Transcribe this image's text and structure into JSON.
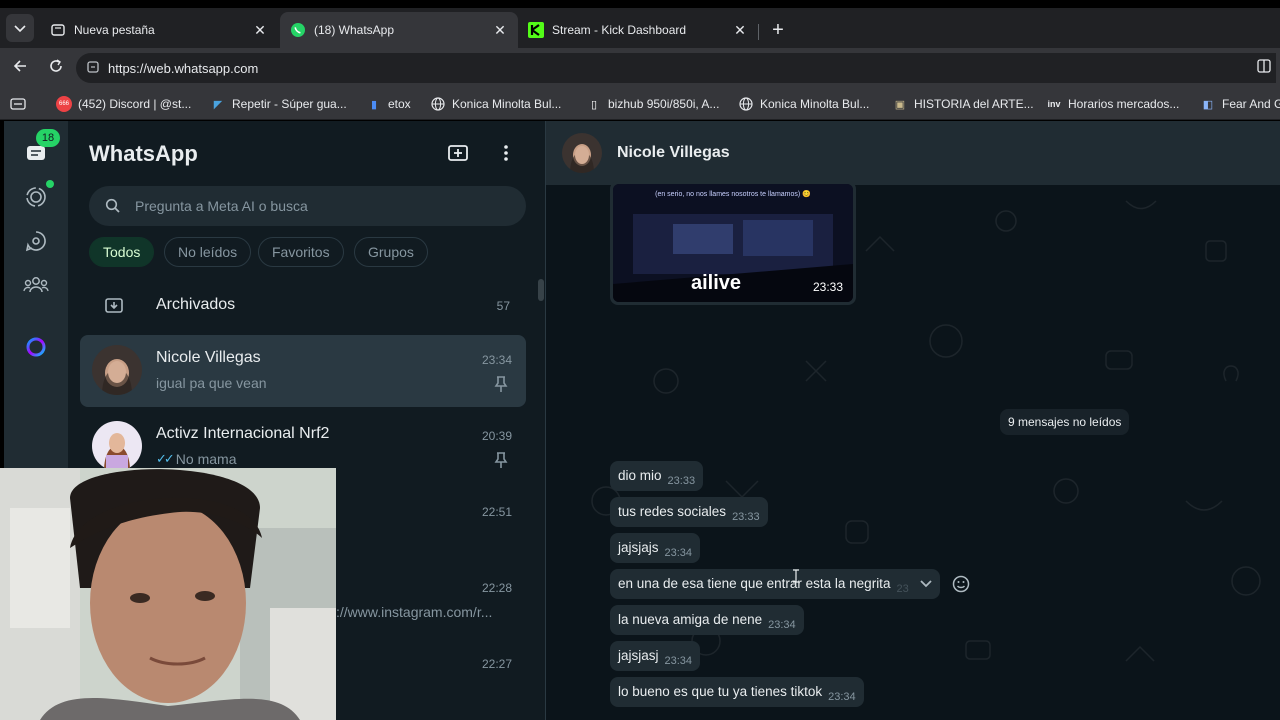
{
  "browser": {
    "tabs": [
      {
        "title": "Nueva pestaña",
        "favicon": "newtab-icon"
      },
      {
        "title": "(18) WhatsApp",
        "favicon": "whatsapp-icon"
      },
      {
        "title": "Stream - Kick Dashboard",
        "favicon": "kick-icon"
      }
    ],
    "url": "https://web.whatsapp.com",
    "bookmarks": [
      "(452) Discord | @st...",
      "Repetir - Súper gua...",
      "etox",
      "Konica Minolta Bul...",
      "bizhub 950i/850i, A...",
      "Konica Minolta Bul...",
      "HISTORIA del ARTE...",
      "Horarios mercados...",
      "Fear And G"
    ],
    "discord_badge": "666"
  },
  "rail": {
    "chats_badge": "18"
  },
  "sidebar": {
    "title": "WhatsApp",
    "search_placeholder": "Pregunta a Meta AI o busca",
    "filters": [
      "Todos",
      "No leídos",
      "Favoritos",
      "Grupos"
    ],
    "archived_label": "Archivados",
    "archived_count": "57",
    "chats": [
      {
        "name": "Nicole Villegas",
        "time": "23:34",
        "preview": "igual pa que vean"
      },
      {
        "name": "Activz Internacional Nrf2",
        "time": "20:39",
        "preview": "No mama"
      },
      {
        "name": "",
        "time": "22:51",
        "preview": ""
      },
      {
        "name": "",
        "time": "22:28",
        "preview": "://www.instagram.com/r..."
      },
      {
        "name": "",
        "time": "22:27",
        "preview": ""
      }
    ]
  },
  "conversation": {
    "contact_name": "Nicole Villegas",
    "media": {
      "caption": "(en serio, no nos llames nosotros te llamamos) 😊",
      "logo": "ailive",
      "time": "23:33"
    },
    "unread_label": "9 mensajes no leídos",
    "messages": [
      {
        "text": "dio mio",
        "time": "23:33"
      },
      {
        "text": "tus redes sociales",
        "time": "23:33"
      },
      {
        "text": "jajsjajs",
        "time": "23:34"
      },
      {
        "text": "en una de esa tiene que entrar esta la negrita",
        "time": "23"
      },
      {
        "text": "la nueva amiga de nene",
        "time": "23:34"
      },
      {
        "text": "jajsjasj",
        "time": "23:34"
      },
      {
        "text": "lo bueno es que tu ya tienes tiktok",
        "time": "23:34"
      }
    ]
  },
  "colors": {
    "accent_green": "#25d366",
    "panel": "#202c33",
    "background": "#111b21"
  }
}
